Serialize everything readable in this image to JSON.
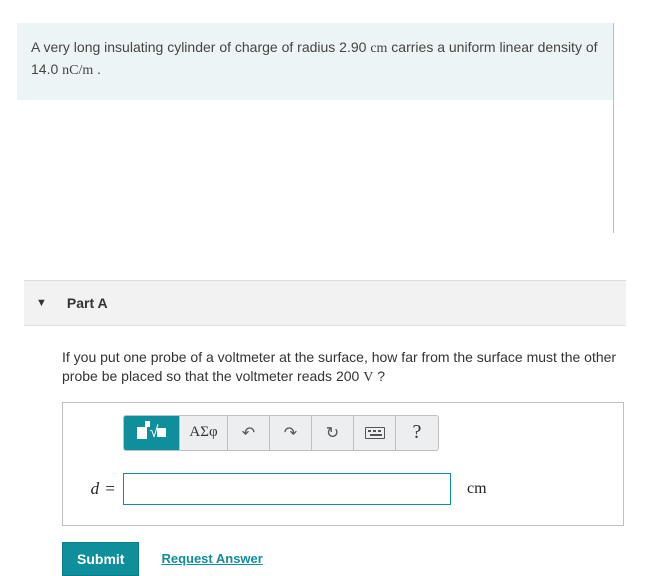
{
  "problem": {
    "text_before": "A very long insulating cylinder of charge of radius 2.90 ",
    "unit1": "cm",
    "text_mid": " carries a uniform linear density of 14.0 ",
    "unit2": "nC/m",
    "text_after": " ."
  },
  "part": {
    "label": "Part A",
    "question_before": "If you put one probe of a voltmeter at the surface, how far from the surface must the other probe be placed so that the voltmeter reads 200 ",
    "question_unit": "V",
    "question_after": " ?"
  },
  "toolbar": {
    "greek": "ΑΣφ",
    "help": "?"
  },
  "answer": {
    "variable": "d",
    "equals": " =",
    "value": "",
    "unit": "cm"
  },
  "actions": {
    "submit": "Submit",
    "request": "Request Answer"
  }
}
